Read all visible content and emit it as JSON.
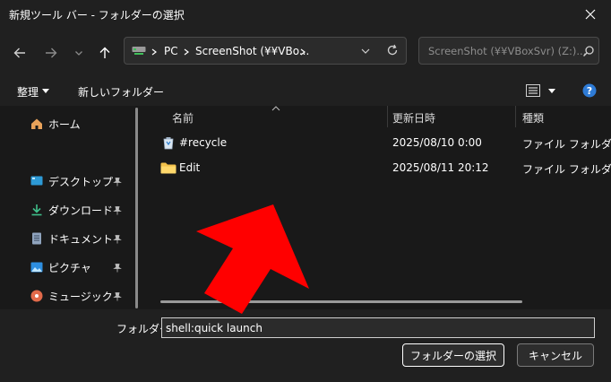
{
  "window": {
    "title": "新規ツール バー - フォルダーの選択",
    "close_icon": "close-icon"
  },
  "nav": {
    "back_icon": "arrow-left-icon",
    "forward_icon": "arrow-right-icon",
    "recent_icon": "chevron-down-icon",
    "up_icon": "arrow-up-icon",
    "refresh_icon": "refresh-icon"
  },
  "address": {
    "drive_icon": "network-drive-icon",
    "crumbs": [
      "PC",
      "ScreenShot (¥¥VBo..."
    ]
  },
  "search": {
    "placeholder": "ScreenShot (¥¥VBoxSvr) (Z:)...",
    "icon": "search-icon"
  },
  "commands": {
    "organize": "整理",
    "new_folder": "新しいフォルダー",
    "view_icon": "view-list-icon",
    "help_icon": "help-icon"
  },
  "sidebar": {
    "items": [
      {
        "label": "ホーム",
        "icon": "home-icon",
        "pinned": false
      },
      {
        "label": "デスクトップ",
        "icon": "desktop-icon",
        "pinned": true
      },
      {
        "label": "ダウンロード",
        "icon": "download-icon",
        "pinned": true
      },
      {
        "label": "ドキュメント",
        "icon": "document-icon",
        "pinned": true
      },
      {
        "label": "ピクチャ",
        "icon": "pictures-icon",
        "pinned": true
      },
      {
        "label": "ミュージック",
        "icon": "music-icon",
        "pinned": true
      }
    ]
  },
  "files": {
    "columns": [
      "名前",
      "更新日時",
      "種類"
    ],
    "rows": [
      {
        "name": "#recycle",
        "modified": "2025/08/10 0:00",
        "type": "ファイル フォルダー",
        "icon": "recycle-bin-icon"
      },
      {
        "name": "Edit",
        "modified": "2025/08/11 20:12",
        "type": "ファイル フォルダー",
        "icon": "folder-icon"
      }
    ]
  },
  "footer": {
    "folder_label": "フォルダー:",
    "folder_value": "shell:quick launch",
    "select_button": "フォルダーの選択",
    "cancel_button": "キャンセル"
  },
  "overlay": {
    "arrow_color": "#ff0000",
    "arrow_icon": "red-pointer-arrow"
  }
}
